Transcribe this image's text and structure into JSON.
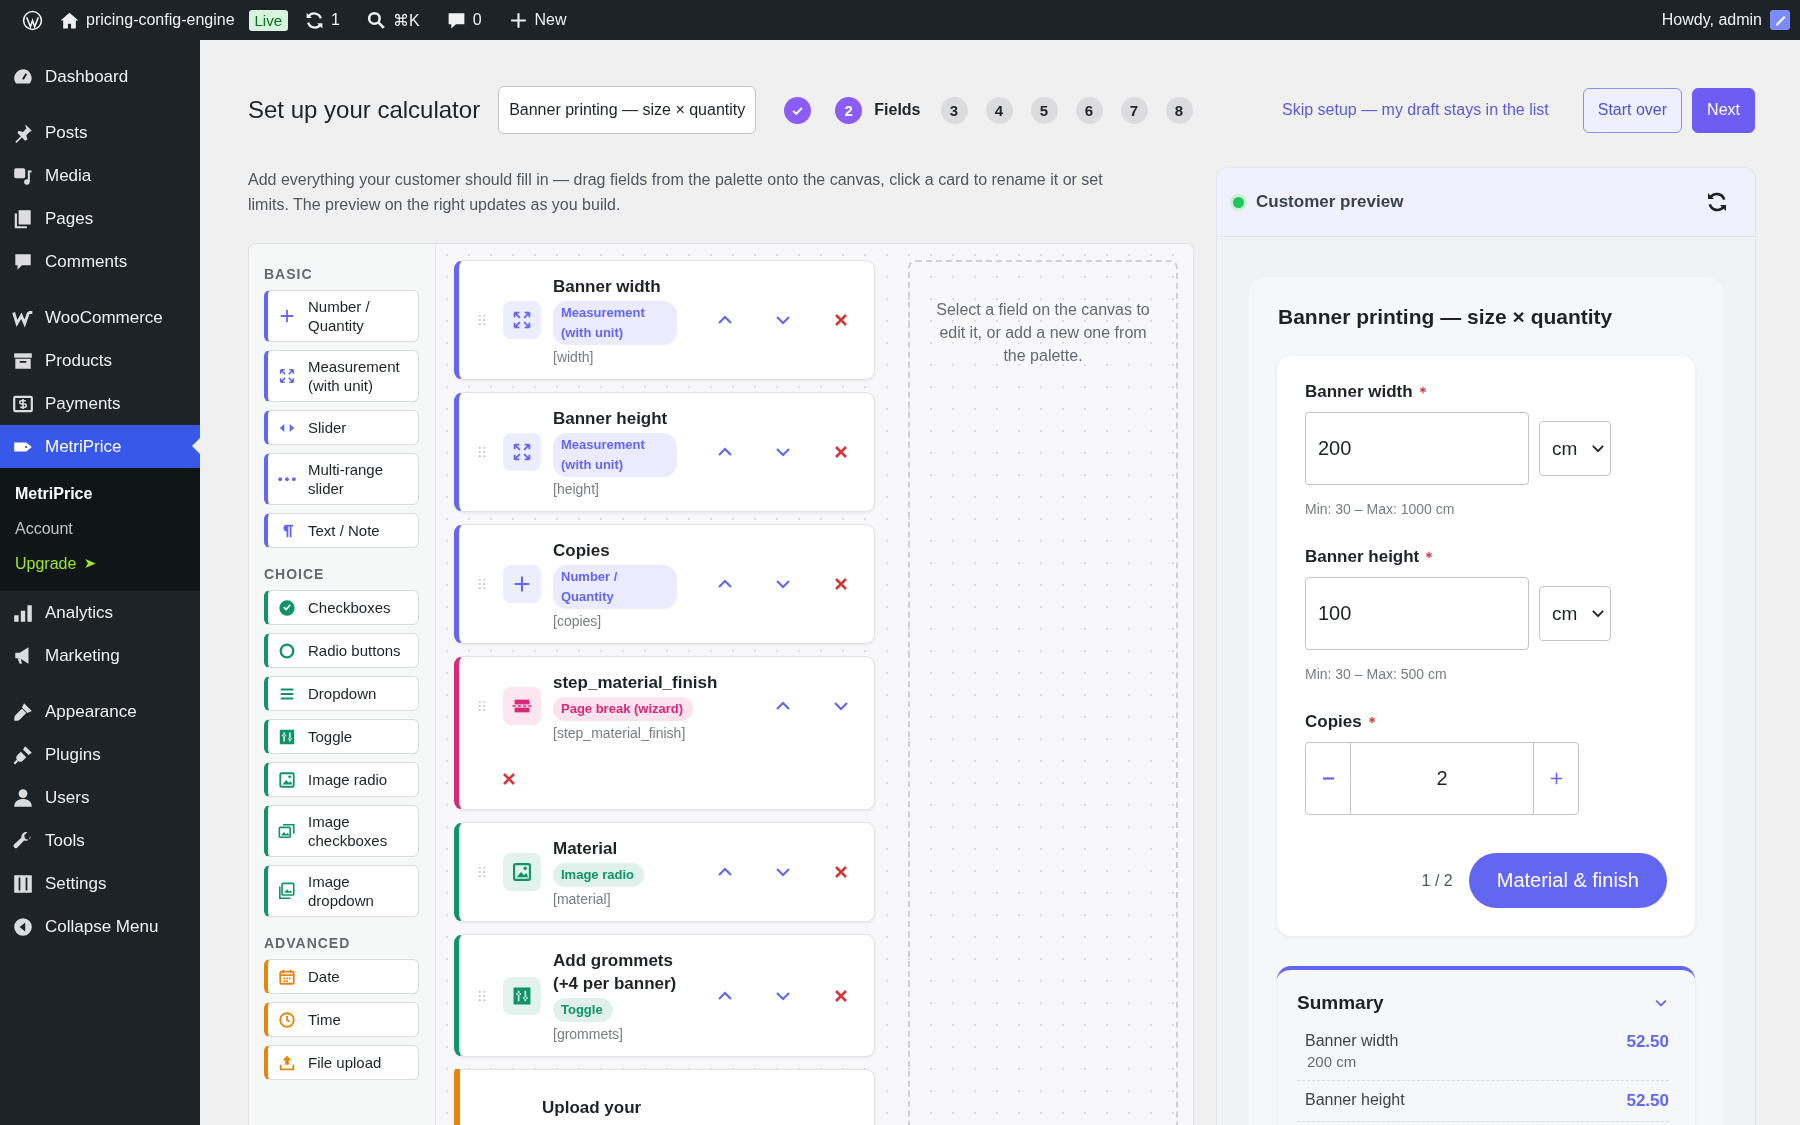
{
  "topbar": {
    "site": "pricing-config-engine",
    "status": "Live",
    "updates": "1",
    "search": "⌘K",
    "comments": "0",
    "new": "New",
    "greeting": "Howdy, admin"
  },
  "sidebar": {
    "groups": [
      [
        {
          "label": "Dashboard",
          "selected": false
        }
      ],
      [
        {
          "label": "Posts",
          "selected": false
        },
        {
          "label": "Media",
          "selected": false
        },
        {
          "label": "Pages",
          "selected": false
        },
        {
          "label": "Comments",
          "selected": false
        }
      ],
      [
        {
          "label": "WooCommerce",
          "selected": false
        },
        {
          "label": "Products",
          "selected": false
        },
        {
          "label": "Payments",
          "selected": false
        },
        {
          "label": "MetriPrice",
          "selected": true,
          "submenu": [
            {
              "label": "MetriPrice",
              "selected": true,
              "kind": "link"
            },
            {
              "label": "Account",
              "selected": false,
              "kind": "link"
            },
            {
              "label": "Upgrade",
              "selected": false,
              "kind": "upgrade"
            }
          ]
        },
        {
          "label": "Analytics",
          "selected": false
        },
        {
          "label": "Marketing",
          "selected": false
        }
      ],
      [
        {
          "label": "Appearance",
          "selected": false
        },
        {
          "label": "Plugins",
          "selected": false
        },
        {
          "label": "Users",
          "selected": false
        },
        {
          "label": "Tools",
          "selected": false
        },
        {
          "label": "Settings",
          "selected": false
        },
        {
          "label": "Collapse Menu",
          "selected": false
        }
      ]
    ]
  },
  "header": {
    "title": "Set up your calculator",
    "name_field": "Banner printing — size × quantity",
    "steps": [
      {
        "kind": "done"
      },
      {
        "kind": "current",
        "number": "2",
        "label": "Fields"
      },
      {
        "kind": "todo",
        "number": "3"
      },
      {
        "kind": "todo",
        "number": "4"
      },
      {
        "kind": "todo",
        "number": "5"
      },
      {
        "kind": "todo",
        "number": "6"
      },
      {
        "kind": "todo",
        "number": "7"
      },
      {
        "kind": "todo",
        "number": "8"
      }
    ],
    "skip_link": "Skip setup — my draft stays in the list",
    "buttons": [
      {
        "label": "Start over",
        "kind": "secondary"
      },
      {
        "label": "Next",
        "kind": "primary"
      }
    ]
  },
  "description": "Add everything your customer should fill in — drag fields from the palette onto the canvas, click a card to rename it or set limits. The preview on the right updates as you build.",
  "palette": {
    "sections": [
      {
        "title": "BASIC",
        "color": "#6366f1",
        "items": [
          "Number / Quantity",
          "Measurement (with unit)",
          "Slider",
          "Multi-range slider",
          "Text / Note"
        ]
      },
      {
        "title": "CHOICE",
        "color": "#0f9466",
        "items": [
          "Checkboxes",
          "Radio buttons",
          "Dropdown",
          "Toggle",
          "Image radio",
          "Image checkboxes",
          "Image dropdown"
        ]
      },
      {
        "title": "ADVANCED",
        "color": "#e6850e",
        "items": [
          "Date",
          "Time",
          "File upload"
        ]
      }
    ]
  },
  "canvas": {
    "cards": [
      {
        "kind": "field",
        "title": "Banner width",
        "type": "Measurement (with unit)",
        "key": "[width]",
        "color": "#6366f1"
      },
      {
        "kind": "field",
        "title": "Banner height",
        "type": "Measurement (with unit)",
        "key": "[height]",
        "color": "#6366f1"
      },
      {
        "kind": "field",
        "title": "Copies",
        "type": "Number / Quantity",
        "key": "[copies]",
        "color": "#6366f1"
      },
      {
        "kind": "page_break",
        "title": "step_material_finish",
        "type": "Page break (wizard)",
        "key": "[step_material_finish]",
        "color": "#db2777"
      },
      {
        "kind": "field",
        "title": "Material",
        "type": "Image radio",
        "key": "[material]",
        "color": "#0f9466"
      },
      {
        "kind": "field",
        "title": "Add grommets (+4 per banner)",
        "type": "Toggle",
        "key": "[grommets]",
        "color": "#0f9466"
      },
      {
        "kind": "partial",
        "title": "Upload your",
        "color": "#e6850e"
      }
    ],
    "hint": "Select a field on the canvas to edit it, or add a new one from the palette."
  },
  "preview": {
    "title": "Customer preview",
    "live": true,
    "form": {
      "title": "Banner printing — size × quantity",
      "fields": [
        {
          "kind": "measure",
          "label": "Banner width",
          "required": true,
          "value": "200",
          "unit": "cm",
          "hint": "Min: 30 – Max: 1000 cm"
        },
        {
          "kind": "measure",
          "label": "Banner height",
          "required": true,
          "value": "100",
          "unit": "cm",
          "hint": "Min: 30 – Max: 500 cm"
        },
        {
          "kind": "stepper",
          "label": "Copies",
          "required": true,
          "value": "2"
        }
      ],
      "page": "1 / 2",
      "next_button": "Material & finish"
    },
    "summary": {
      "title": "Summary",
      "expanded": true,
      "rows": [
        {
          "label": "Banner width",
          "detail": "200 cm",
          "value": "52.50"
        },
        {
          "label": "Banner height",
          "value": "52.50"
        }
      ]
    }
  }
}
